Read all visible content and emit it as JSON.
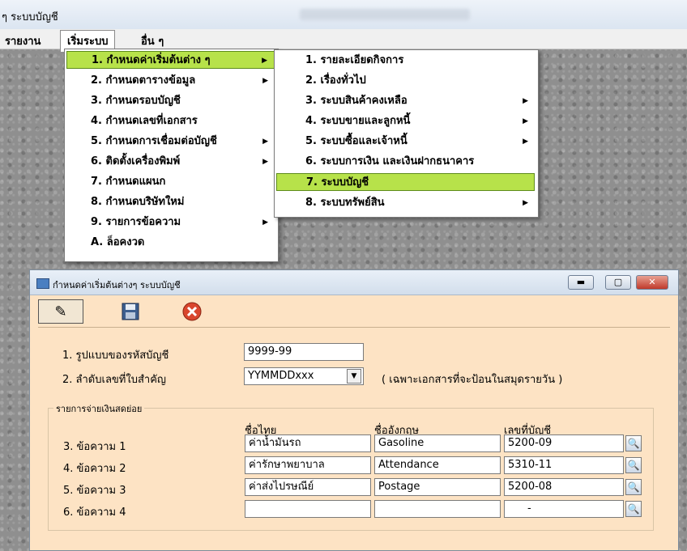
{
  "window_title": "ๆ ระบบบัญชี",
  "menubar": {
    "items": [
      "รายงาน",
      "เริ่มระบบ",
      "อื่น ๆ"
    ],
    "active": "เริ่มระบบ"
  },
  "menu1": {
    "items": [
      "1. กำหนดค่าเริ่มต้นต่าง ๆ",
      "2. กำหนดตารางข้อมูล",
      "3. กำหนดรอบบัญชี",
      "4. กำหนดเลขที่เอกสาร",
      "5. กำหนดการเชื่อมต่อบัญชี",
      "6. ติดตั้งเครื่องพิมพ์",
      "7. กำหนดแผนก",
      "8. กำหนดบริษัทใหม่",
      "9. รายการข้อความ",
      "A. ล็อคงวด"
    ]
  },
  "menu2": {
    "items": [
      "1. รายละเอียดกิจการ",
      "2. เรื่องทั่วไป",
      "3. ระบบสินค้าคงเหลือ",
      "4. ระบบขายและลูกหนี้",
      "5. ระบบซื้อและเจ้าหนี้",
      "6. ระบบการเงิน และเงินฝากธนาคาร",
      "7. ระบบบัญชี",
      "8. ระบบทรัพย์สิน"
    ]
  },
  "dialog": {
    "title": "กำหนดค่าเริ่มต้นต่างๆ ระบบบัญชี",
    "label_1": "1. รูปแบบของรหัสบัญชี",
    "value_1": "9999-99",
    "label_2": "2. ลำดับเลขที่ใบสำคัญ",
    "value_2": "YYMMDDxxx",
    "note_2": "( เฉพาะเอกสารที่จะป้อนในสมุดรายวัน )",
    "group_title": "รายการจ่ายเงินสดย่อย",
    "columns": [
      "ชื่อไทย",
      "ชื่ออังกฤษ",
      "เลขที่บัญชี"
    ],
    "rows": [
      {
        "label": "3. ข้อความ 1",
        "thai": "ค่าน้ำมันรถ",
        "english": "Gasoline",
        "account": "5200-09"
      },
      {
        "label": "4. ข้อความ 2",
        "thai": "ค่ารักษาพยาบาล",
        "english": "Attendance",
        "account": "5310-11"
      },
      {
        "label": "5. ข้อความ 3",
        "thai": "ค่าส่งไปรษณีย์",
        "english": "Postage",
        "account": "5200-08"
      },
      {
        "label": "6. ข้อความ 4",
        "thai": "",
        "english": "",
        "account": "-"
      }
    ]
  },
  "colors": {
    "highlight": "#b7e24a",
    "dialog_bg": "#fde3c4"
  }
}
